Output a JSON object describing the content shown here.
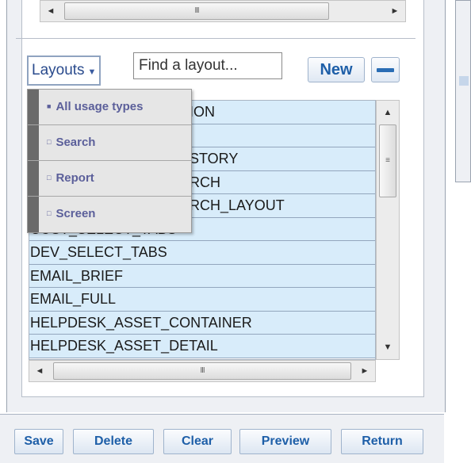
{
  "layouts_panel": {
    "dropdown_label": "Layouts",
    "dropdown_caret": "▼",
    "search": {
      "placeholder": "Find a layout...",
      "value": ""
    },
    "new_button": "New",
    "remove_button_icon": "minus-icon"
  },
  "scrollbar": {
    "left_arrow": "◄",
    "right_arrow": "►",
    "up_arrow": "▲",
    "down_arrow": "▼",
    "grip": "III",
    "grip_vertical": "≡"
  },
  "usage_menu": {
    "items": [
      {
        "label": "All usage types",
        "glyph": "■",
        "selected": true
      },
      {
        "label": "Search",
        "glyph": "□",
        "selected": false
      },
      {
        "label": "Report",
        "glyph": "□",
        "selected": false
      },
      {
        "label": "Screen",
        "glyph": "□",
        "selected": false
      }
    ]
  },
  "layout_list": {
    "rows": [
      "ION",
      "",
      "STORY",
      "RCH",
      "RCH_LAYOUT",
      "CUST_SELECT_TABS",
      "DEV_SELECT_TABS",
      "EMAIL_BRIEF",
      "EMAIL_FULL",
      "HELPDESK_ASSET_CONTAINER",
      "HELPDESK_ASSET_DETAIL"
    ]
  },
  "bottom_bar": {
    "buttons": [
      "Save",
      "Delete",
      "Clear",
      "Preview",
      "Return"
    ]
  },
  "colors": {
    "list_row_bg": "#d8ecfa",
    "accent_blue": "#1e5fa8",
    "menu_text": "#5b5f9a"
  }
}
